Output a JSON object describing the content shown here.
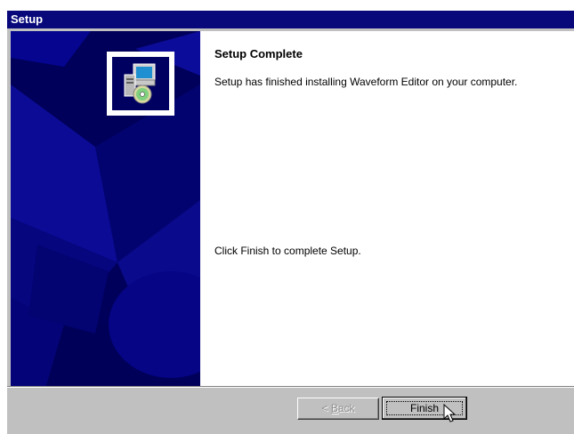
{
  "window": {
    "title": "Setup"
  },
  "content": {
    "heading": "Setup Complete",
    "message": "Setup has finished installing Waveform Editor on your computer.",
    "instruction": "Click Finish to complete Setup."
  },
  "buttons": {
    "back_prefix": "< ",
    "back_mnemonic": "B",
    "back_rest": "ack",
    "back_enabled": false,
    "finish": "Finish"
  },
  "colors": {
    "titlebar": "#08087b",
    "left_panel": "#000060",
    "dialog": "#c0c0c0"
  },
  "icons": [
    "setup-computer-cd-icon",
    "mouse-pointer-icon"
  ]
}
